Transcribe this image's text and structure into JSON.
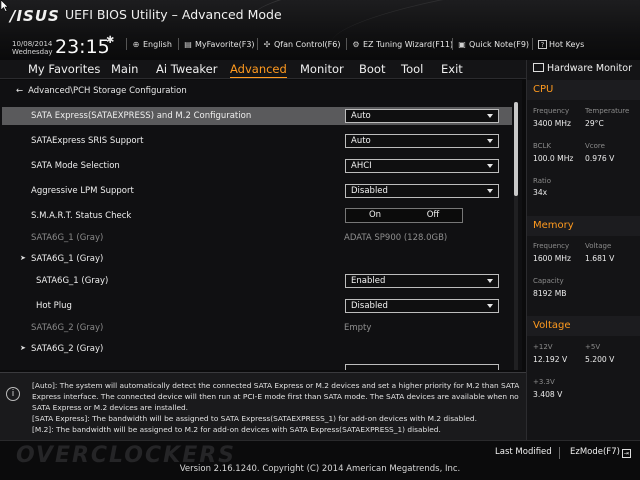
{
  "window": {
    "logo": "/ISUS",
    "title": "UEFI BIOS Utility – Advanced Mode"
  },
  "clock": {
    "date": "10/08/2014",
    "day": "Wednesday",
    "time": "23:15"
  },
  "toolbar": [
    {
      "icon": "globe-icon",
      "glyph": "⊕",
      "label": "English"
    },
    {
      "icon": "favorite-icon",
      "glyph": "▤",
      "label": "MyFavorite(F3)"
    },
    {
      "icon": "fan-icon",
      "glyph": "✣",
      "label": "Qfan Control(F6)"
    },
    {
      "icon": "tuning-icon",
      "glyph": "⚙",
      "label": "EZ Tuning Wizard(F11)"
    },
    {
      "icon": "note-icon",
      "glyph": "▣",
      "label": "Quick Note(F9)"
    },
    {
      "icon": "hotkeys-icon",
      "glyph": "?",
      "label": "Hot Keys"
    }
  ],
  "menu": {
    "items": [
      "My Favorites",
      "Main",
      "Ai Tweaker",
      "Advanced",
      "Monitor",
      "Boot",
      "Tool",
      "Exit"
    ],
    "active": "Advanced"
  },
  "breadcrumb": "Advanced\\PCH Storage Configuration",
  "settings": {
    "sata_express_m2": {
      "label": "SATA Express(SATAEXPRESS) and M.2 Configuration",
      "value": "Auto"
    },
    "sris": {
      "label": "SATAExpress SRIS Support",
      "value": "Auto"
    },
    "sata_mode": {
      "label": "SATA Mode Selection",
      "value": "AHCI"
    },
    "lpm": {
      "label": "Aggressive LPM Support",
      "value": "Disabled"
    },
    "smart": {
      "label": "S.M.A.R.T. Status Check",
      "on": "On",
      "off": "Off"
    },
    "sata6g1_info": {
      "label": "SATA6G_1 (Gray)",
      "value": "ADATA SP900 (128.0GB)"
    },
    "sata6g1_group": {
      "label": "SATA6G_1 (Gray)"
    },
    "sata6g1_port": {
      "label": "SATA6G_1 (Gray)",
      "value": "Enabled"
    },
    "hotplug": {
      "label": "Hot Plug",
      "value": "Disabled"
    },
    "sata6g2_info": {
      "label": "SATA6G_2 (Gray)",
      "value": "Empty"
    },
    "sata6g2_group": {
      "label": "SATA6G_2 (Gray)"
    }
  },
  "help": {
    "lines": [
      "[Auto]: The system will automatically detect the connected SATA Express or M.2 devices and set a higher priority for M.2 than SATA",
      "Express interface. The connected device will then run at PCI-E mode first than SATA mode. The SATA devices are available when no",
      "SATA Express or M.2 devices are installed.",
      "[SATA Express]: The bandwidth will be assigned to SATA Express(SATAEXPRESS_1) for add-on devices with M.2 disabled.",
      "[M.2]: The bandwidth will be assigned to M.2 for add-on devices with SATA Express(SATAEXPRESS_1) disabled."
    ]
  },
  "hardware_monitor": {
    "title": "Hardware Monitor",
    "cpu": {
      "heading": "CPU",
      "frequency_label": "Frequency",
      "frequency": "3400 MHz",
      "temperature_label": "Temperature",
      "temperature": "29°C",
      "bclk_label": "BCLK",
      "bclk": "100.0 MHz",
      "vcore_label": "Vcore",
      "vcore": "0.976 V",
      "ratio_label": "Ratio",
      "ratio": "34x"
    },
    "memory": {
      "heading": "Memory",
      "frequency_label": "Frequency",
      "frequency": "1600 MHz",
      "voltage_label": "Voltage",
      "voltage": "1.681 V",
      "capacity_label": "Capacity",
      "capacity": "8192 MB"
    },
    "voltage": {
      "heading": "Voltage",
      "v12_label": "+12V",
      "v12": "12.192 V",
      "v5_label": "+5V",
      "v5": "5.200 V",
      "v33_label": "+3.3V",
      "v33": "3.408 V"
    }
  },
  "footer": {
    "watermark": "OVERCLOCKERS",
    "last_modified": "Last Modified",
    "ezmode": "EzMode(F7)",
    "version": "Version 2.16.1240. Copyright (C) 2014 American Megatrends, Inc."
  }
}
